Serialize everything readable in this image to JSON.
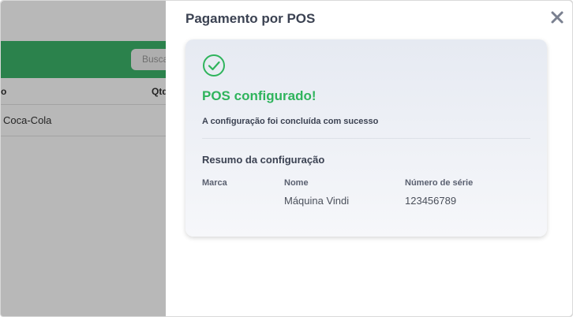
{
  "background": {
    "search_placeholder": "Busca",
    "table_headers": [
      "to",
      "Qtd"
    ],
    "row_text": "Coca-Cola",
    "accent_color": "#3cb46a"
  },
  "drawer": {
    "title": "Pagamento por POS",
    "close_icon": "close-icon",
    "card": {
      "status_icon": "check-circle-icon",
      "success_title": "POS configurado!",
      "success_subtitle": "A configuração foi concluída com sucesso",
      "summary_title": "Resumo da configuração",
      "columns": [
        {
          "label": "Marca",
          "value": ""
        },
        {
          "label": "Nome",
          "value": "Máquina Vindi"
        },
        {
          "label": "Número de série",
          "value": "123456789"
        }
      ],
      "success_color": "#2fb45c"
    }
  }
}
